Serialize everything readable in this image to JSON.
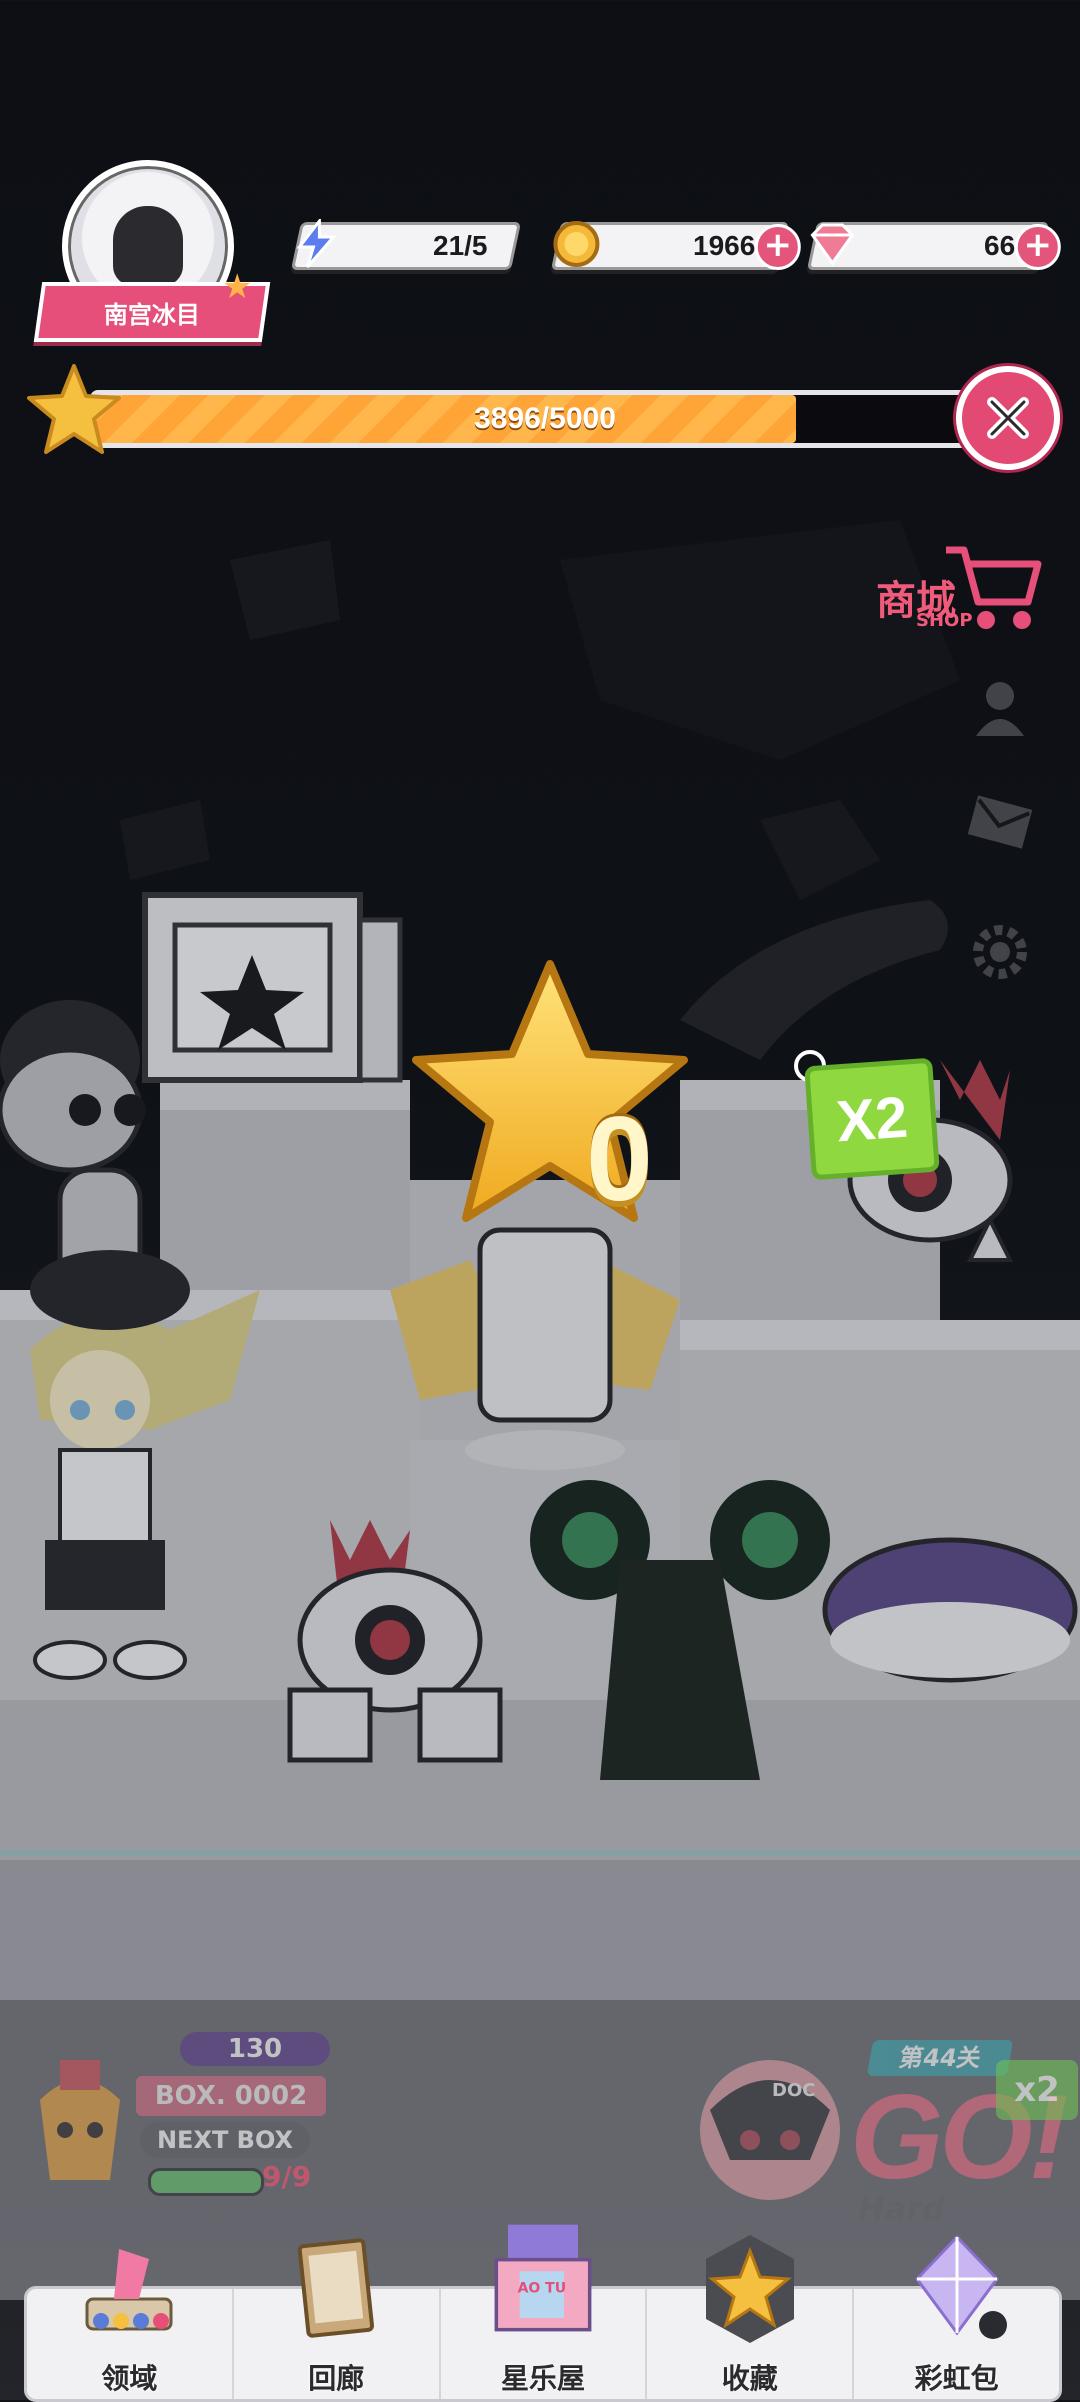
{
  "player": {
    "name": "南宫冰目"
  },
  "resources": {
    "energy": {
      "value": "21/5",
      "icon": "lightning-icon"
    },
    "coins": {
      "value": "1966",
      "icon": "coin-icon"
    },
    "gems": {
      "value": "66",
      "icon": "gem-icon"
    }
  },
  "progress": {
    "text": "3896/5000",
    "current": 3896,
    "max": 5000
  },
  "side_menu": {
    "shop_label": "商城",
    "shop_sub": "SHOP"
  },
  "center": {
    "count": "0",
    "multiplier": "X2"
  },
  "box_panel": {
    "gems": "130",
    "box_number": "BOX. 0002",
    "next_box": "NEXT BOX",
    "count": "9/9"
  },
  "go_panel": {
    "level": "第44关",
    "go": "GO!",
    "difficulty": "Hard",
    "multiplier": "x2",
    "character_label": "DOC"
  },
  "nav": [
    {
      "label": "领域",
      "icon": "domain-icon"
    },
    {
      "label": "回廊",
      "icon": "gallery-icon"
    },
    {
      "label": "星乐屋",
      "icon": "star-house-icon",
      "box_text": "AO TU"
    },
    {
      "label": "收藏",
      "icon": "collection-star-icon"
    },
    {
      "label": "彩虹包",
      "icon": "rainbow-pack-icon"
    }
  ],
  "colors": {
    "accent_pink": "#e54f79",
    "star_gold": "#f5c040",
    "progress_orange": "#ffb64a",
    "x2_green": "#8fd83f"
  }
}
